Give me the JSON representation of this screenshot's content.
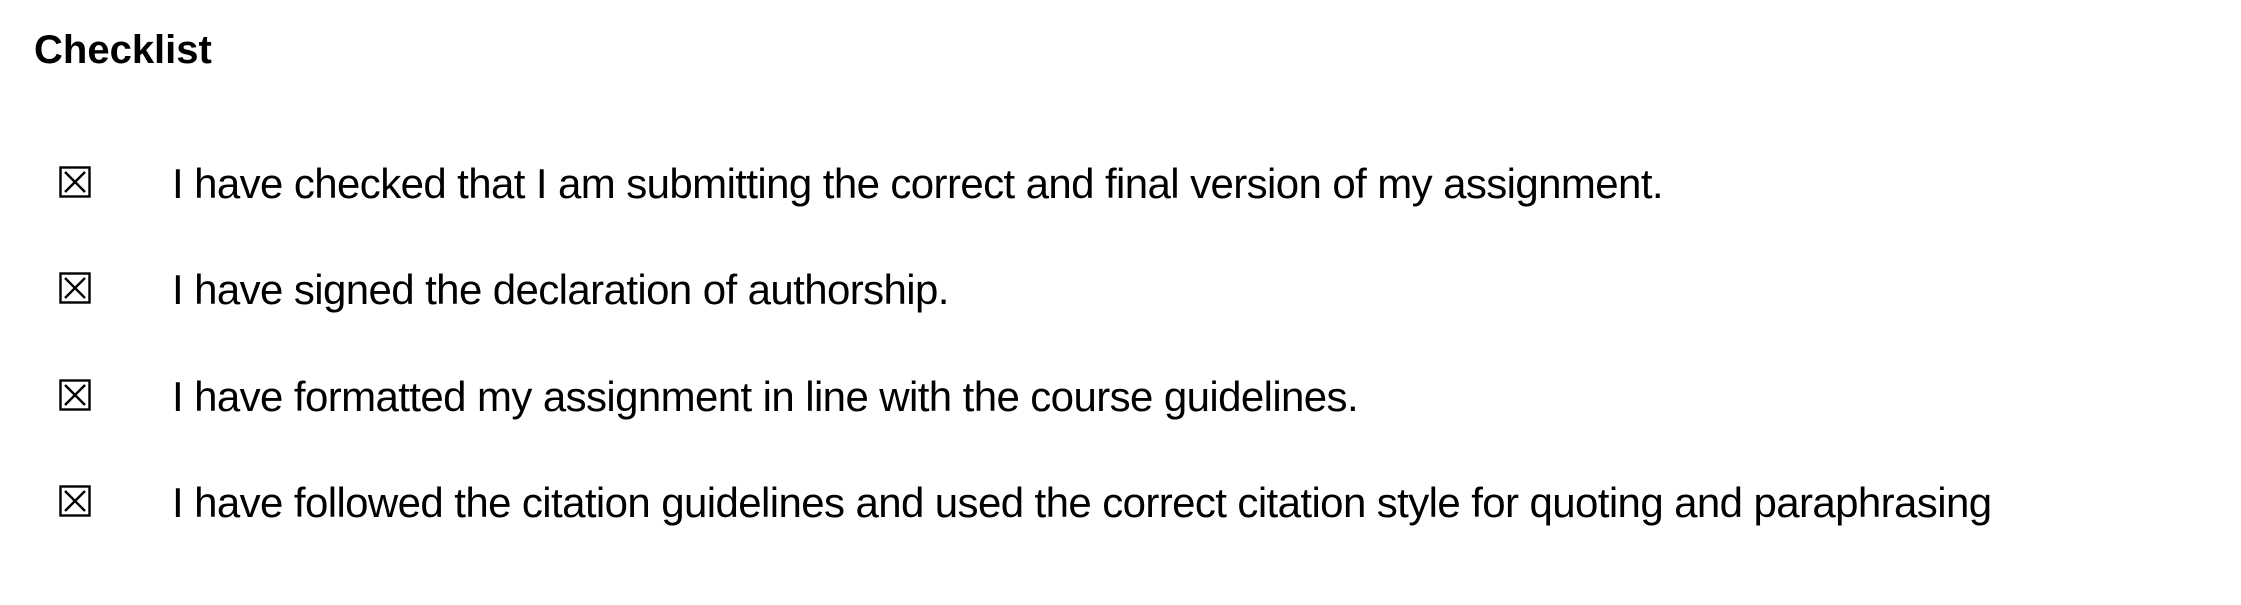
{
  "heading": "Checklist",
  "items": [
    {
      "label": "I have checked that I am submitting the correct and final version of my assignment.",
      "checked": true,
      "icon": "checked-box-icon"
    },
    {
      "label": "I have signed the declaration of authorship.",
      "checked": true,
      "icon": "checked-box-icon"
    },
    {
      "label": "I have formatted my assignment in line with the course guidelines.",
      "checked": true,
      "icon": "checked-box-icon"
    },
    {
      "label": "I have followed the citation guidelines and used the correct citation style for quoting and paraphrasing",
      "checked": true,
      "icon": "checked-box-icon"
    }
  ],
  "colors": {
    "text": "#000000",
    "background": "#ffffff"
  }
}
